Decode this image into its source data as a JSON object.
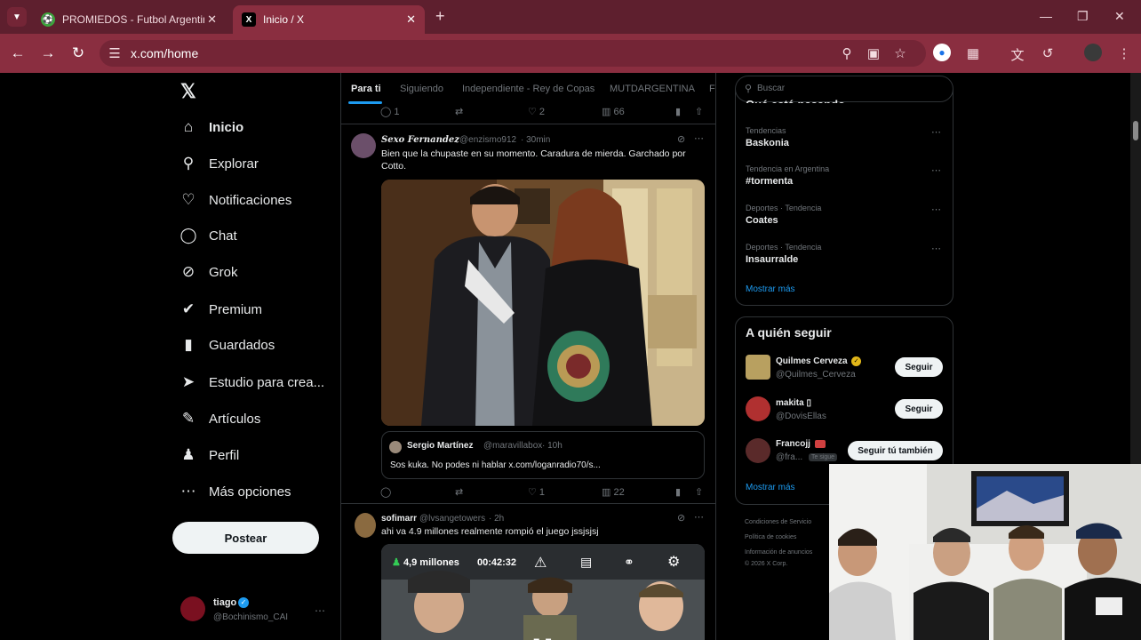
{
  "browser": {
    "tabs": [
      {
        "title": "PROMIEDOS - Futbol Argentino"
      },
      {
        "title": "Inicio / X"
      }
    ],
    "url": "x.com/home"
  },
  "sidebar": {
    "items": [
      {
        "label": "Inicio",
        "icon": "home-icon"
      },
      {
        "label": "Explorar",
        "icon": "search-icon"
      },
      {
        "label": "Notificaciones",
        "icon": "bell-icon"
      },
      {
        "label": "Chat",
        "icon": "chat-icon"
      },
      {
        "label": "Grok",
        "icon": "grok-icon"
      },
      {
        "label": "Premium",
        "icon": "premium-icon"
      },
      {
        "label": "Guardados",
        "icon": "bookmark-icon"
      },
      {
        "label": "Estudio para crea...",
        "icon": "rocket-icon"
      },
      {
        "label": "Artículos",
        "icon": "article-icon"
      },
      {
        "label": "Perfil",
        "icon": "person-icon"
      },
      {
        "label": "Más opciones",
        "icon": "more-icon"
      }
    ],
    "post_label": "Postear",
    "account": {
      "name": "tiago",
      "handle": "@Bochinismo_CAI"
    }
  },
  "feed": {
    "tabs": [
      "Para ti",
      "Siguiendo",
      "Independiente - Rey de Copas",
      "MUTDARGENTINA",
      "F"
    ],
    "prev_actions": {
      "replies": "1",
      "reposts": "",
      "likes": "2",
      "views": "66"
    },
    "post1": {
      "name": "Sexo Fernandez",
      "handle": "@enzismo912",
      "time": "· 30min",
      "text": "Bien que la chupaste en su momento. Caradura de mierda. Garchado por Cotto.",
      "quote": {
        "name": "Sergio Martínez",
        "handle": "@maravillabox",
        "time": "· 10h",
        "text": "Sos kuka. No podes ni hablar x.com/loganradio70/s..."
      },
      "actions": {
        "replies": "",
        "reposts": "",
        "likes": "1",
        "views": "22"
      }
    },
    "post2": {
      "name": "sofimarr",
      "handle": "@lvsangetowers",
      "time": "· 2h",
      "text": "ahi va 4.9 millones realmente rompió el juego jssjsjsj",
      "video": {
        "viewers": "4,9 millones",
        "time": "00:42:32"
      }
    }
  },
  "right": {
    "search_placeholder": "Buscar",
    "trends_title": "Qué está pasando",
    "trends": [
      {
        "category": "Tendencias",
        "name": "Baskonia"
      },
      {
        "category": "Tendencia en Argentina",
        "name": "#tormenta"
      },
      {
        "category": "Deportes · Tendencia",
        "name": "Coates"
      },
      {
        "category": "Deportes · Tendencia",
        "name": "Insaurralde"
      }
    ],
    "show_more": "Mostrar más",
    "follow_title": "A quién seguir",
    "follow": [
      {
        "name": "Quilmes Cerveza",
        "handle": "@Quilmes_Cerveza",
        "button": "Seguir"
      },
      {
        "name": "makita ▯",
        "handle": "@DovisEllas",
        "button": "Seguir"
      },
      {
        "name": "Francojj",
        "handle": "@fra...",
        "badge": "Te sigue",
        "button": "Seguir tú también"
      }
    ],
    "follow_more": "Mostrar más",
    "footer": [
      "Condiciones de Servicio",
      "Política de cookies",
      "Información de anuncios",
      "© 2026 X Corp."
    ]
  }
}
